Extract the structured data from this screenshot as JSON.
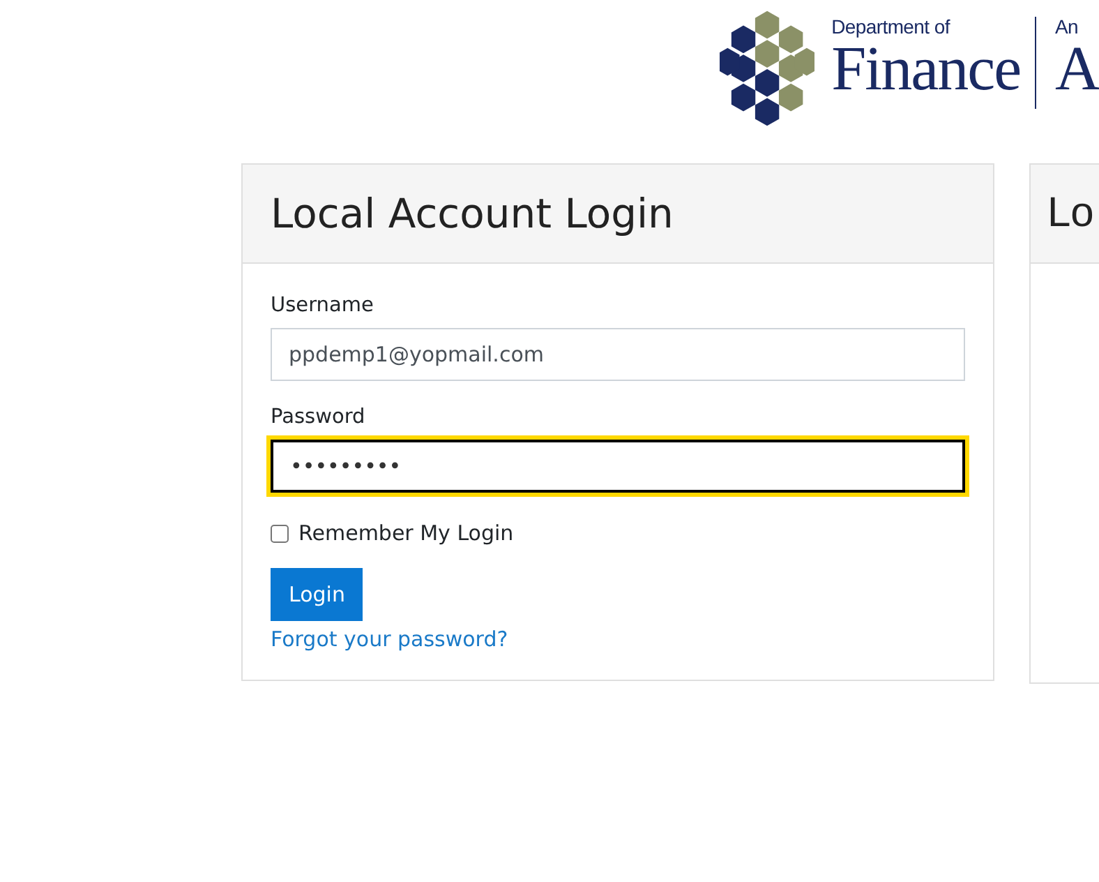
{
  "logo": {
    "department": "Department of",
    "name": "Finance",
    "second_prefix": "An",
    "second_name": "A"
  },
  "panels": [
    {
      "title": "Local Account Login",
      "kind": "form",
      "fields": [
        {
          "label": "Username",
          "value": "ppdemp1@yopmail.com",
          "focused": false
        },
        {
          "label": "Password",
          "value": "•••••••••",
          "focused": true
        }
      ],
      "remember": {
        "label": "Remember My Login",
        "checked": false
      },
      "button": "Login",
      "link": "Forgot your password?"
    },
    {
      "title": "Lo",
      "kind": "empty"
    }
  ]
}
